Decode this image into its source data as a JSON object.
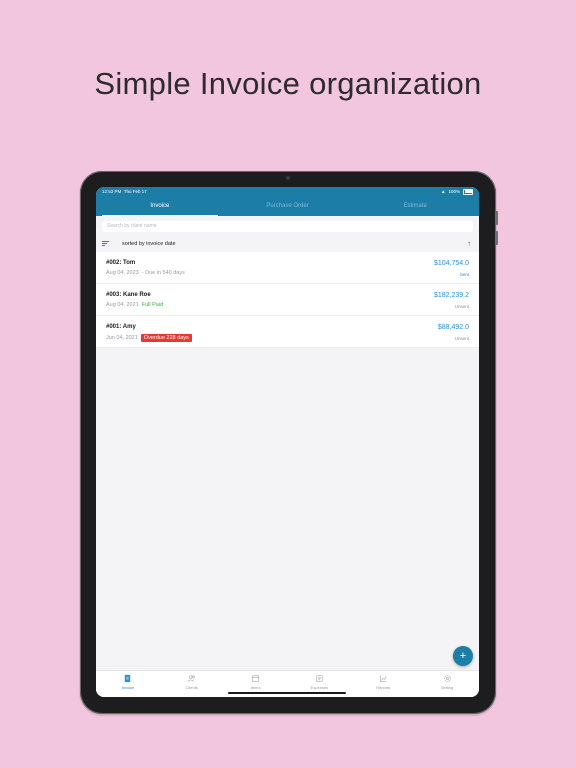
{
  "headline": "Simple Invoice organization",
  "status": {
    "time": "12:53 PM",
    "date": "Thu Feb 17",
    "battery": "100%"
  },
  "tabs": [
    {
      "label": "Invoice",
      "active": true
    },
    {
      "label": "Purchase Order",
      "active": false
    },
    {
      "label": "Estimate",
      "active": false
    }
  ],
  "search": {
    "placeholder": "Search by client name"
  },
  "sort": {
    "label": "sorted by invoice date"
  },
  "invoices": [
    {
      "title": "#002:  Tom",
      "date": "Aug 04, 2023",
      "note": "- Due in 540 days",
      "amount": "$104,754.0",
      "status": "Sent"
    },
    {
      "title": "#003:  Kane Roe",
      "date": "Aug 04, 2021",
      "paid": "Full Paid",
      "amount": "$182,239.2",
      "status": "Unsent"
    },
    {
      "title": "#001:  Amy",
      "date": "Jun 04, 2021",
      "overdue": "Overdue 228 days",
      "amount": "$88,492.0",
      "status": "Unsent"
    }
  ],
  "fab": {
    "label": "+"
  },
  "nav": [
    {
      "label": "Invoice",
      "icon": "invoice-icon",
      "active": true
    },
    {
      "label": "Clients",
      "icon": "clients-icon",
      "active": false
    },
    {
      "label": "Items",
      "icon": "items-icon",
      "active": false
    },
    {
      "label": "Expenses",
      "icon": "expenses-icon",
      "active": false
    },
    {
      "label": "Reports",
      "icon": "reports-icon",
      "active": false
    },
    {
      "label": "Setting",
      "icon": "gear-icon",
      "active": false
    }
  ],
  "colors": {
    "accent": "#1c7ea6",
    "background": "#f2c6de",
    "link": "#2a8fd8",
    "overdue": "#e53935",
    "paid": "#3ab04e"
  }
}
